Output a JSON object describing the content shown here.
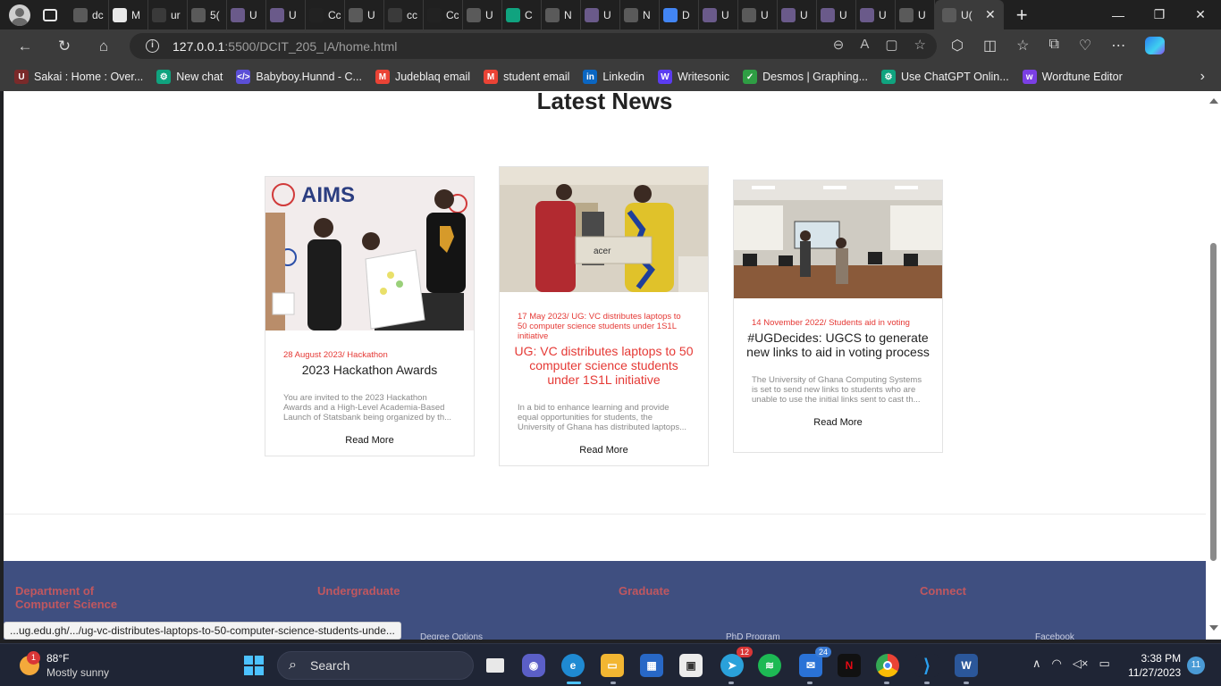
{
  "browser": {
    "tabs": [
      {
        "title": "dc",
        "icon": "page-icon",
        "color": "#5a5a5a"
      },
      {
        "title": "M",
        "icon": "github-icon",
        "color": "#e8e8e8"
      },
      {
        "title": "ur",
        "icon": "search-icon",
        "color": "#3a3a3a"
      },
      {
        "title": "5(",
        "icon": "page-icon",
        "color": "#5a5a5a"
      },
      {
        "title": "U",
        "icon": "ug-icon",
        "color": "#6a5a8a"
      },
      {
        "title": "U",
        "icon": "ug-icon",
        "color": "#6a5a8a"
      },
      {
        "title": "Cc",
        "icon": "dots-icon",
        "color": "#222222"
      },
      {
        "title": "U",
        "icon": "page-icon",
        "color": "#5a5a5a"
      },
      {
        "title": "cc",
        "icon": "search-icon",
        "color": "#3a3a3a"
      },
      {
        "title": "Cc",
        "icon": "dots-icon",
        "color": "#222222"
      },
      {
        "title": "U",
        "icon": "page-icon",
        "color": "#5a5a5a"
      },
      {
        "title": "C",
        "icon": "chatgpt-icon",
        "color": "#10a37f"
      },
      {
        "title": "N",
        "icon": "mail-icon",
        "color": "#5a5a5a"
      },
      {
        "title": "U",
        "icon": "ug-icon",
        "color": "#6a5a8a"
      },
      {
        "title": "N",
        "icon": "mail-icon",
        "color": "#5a5a5a"
      },
      {
        "title": "D",
        "icon": "docs-icon",
        "color": "#4285f4"
      },
      {
        "title": "U",
        "icon": "ug-icon",
        "color": "#6a5a8a"
      },
      {
        "title": "U",
        "icon": "page-icon",
        "color": "#5a5a5a"
      },
      {
        "title": "U",
        "icon": "ug-icon",
        "color": "#6a5a8a"
      },
      {
        "title": "U",
        "icon": "ug-icon",
        "color": "#6a5a8a"
      },
      {
        "title": "U",
        "icon": "ug-icon",
        "color": "#6a5a8a"
      },
      {
        "title": "U",
        "icon": "page-icon",
        "color": "#5a5a5a"
      }
    ],
    "active_tab": {
      "title": "U("
    },
    "url_host": "127.0.0.1",
    "url_rest": ":5500/DCIT_205_IA/home.html",
    "bookmarks": [
      {
        "label": "Sakai : Home : Over...",
        "glyph": "U",
        "color": "#7a2a2a"
      },
      {
        "label": "New chat",
        "glyph": "⚙",
        "color": "#10a37f"
      },
      {
        "label": "Babyboy.Hunnd - C...",
        "glyph": "</>",
        "color": "#5b4fd6"
      },
      {
        "label": "Judeblaq email",
        "glyph": "M",
        "color": "#ea4335"
      },
      {
        "label": "student email",
        "glyph": "M",
        "color": "#ea4335"
      },
      {
        "label": "Linkedin",
        "glyph": "in",
        "color": "#0a66c2"
      },
      {
        "label": "Writesonic",
        "glyph": "W",
        "color": "#5b3cf0"
      },
      {
        "label": "Desmos | Graphing...",
        "glyph": "✓",
        "color": "#2f9e44"
      },
      {
        "label": "Use ChatGPT Onlin...",
        "glyph": "⚙",
        "color": "#10a37f"
      },
      {
        "label": "Wordtune Editor",
        "glyph": "w",
        "color": "#7b3fe4"
      }
    ]
  },
  "page": {
    "section_title": "Latest News",
    "cards": [
      {
        "meta": "28 August 2023/ Hackathon",
        "title": "2023 Hackathon Awards",
        "title_red": false,
        "excerpt": "You are invited to the 2023 Hackathon Awards and a High-Level Academia-Based Launch of Statsbank being organized by th...",
        "read_more": "Read More",
        "img_text": "AIMS",
        "img_sub": "African Institute for Mathematical Sciences GHANA"
      },
      {
        "meta": "17 May 2023/ UG: VC distributes laptops to 50 computer science students under 1S1L initiative",
        "title": "UG: VC distributes laptops to 50 computer science students under 1S1L initiative",
        "title_red": true,
        "excerpt": "In a bid to enhance learning and provide equal opportunities for students, the University of Ghana has distributed laptops...",
        "read_more": "Read More",
        "img_text": "acer"
      },
      {
        "meta": "14 November 2022/ Students aid in voting",
        "title": "#UGDecides: UGCS to generate new links to aid in voting process",
        "title_red": false,
        "excerpt": "The University of Ghana Computing Systems is set to send new links to students who are unable to use the initial links sent to cast th...",
        "read_more": "Read More"
      }
    ],
    "footer": {
      "col1": "Department of Computer Science",
      "col2": "Undergraduate",
      "col3": "Graduate",
      "col4": "Connect",
      "link2": "Degree Options",
      "link3": "PhD Program",
      "link4": "Facebook"
    },
    "status_url": "...ug.edu.gh/.../ug-vc-distributes-laptops-to-50-computer-science-students-unde..."
  },
  "taskbar": {
    "weather_badge": "1",
    "temp": "88°F",
    "condition": "Mostly sunny",
    "search_label": "Search",
    "telegram_badge": "12",
    "mail_badge": "24",
    "time": "3:38 PM",
    "date": "11/27/2023",
    "notifications": "11"
  }
}
